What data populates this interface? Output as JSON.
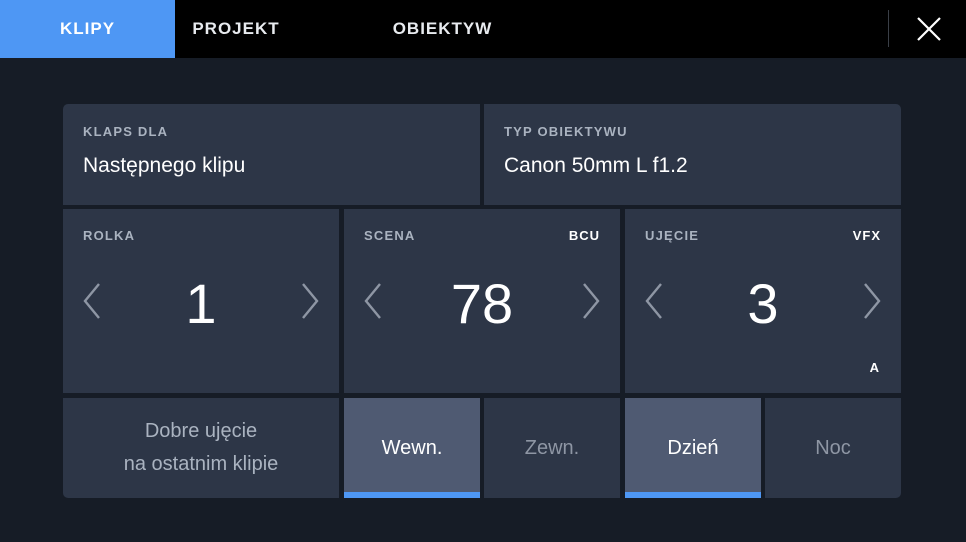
{
  "tabs": [
    {
      "label": "KLIPY",
      "active": true
    },
    {
      "label": "PROJEKT",
      "active": false
    },
    {
      "label": "OBIEKTYW",
      "active": false
    }
  ],
  "slate_for": {
    "label": "KLAPS DLA",
    "value": "Następnego klipu"
  },
  "lens_type": {
    "label": "TYP OBIEKTYWU",
    "value": "Canon 50mm L f1.2"
  },
  "reel": {
    "label": "ROLKA",
    "value": "1"
  },
  "scene": {
    "label": "SCENA",
    "value": "78",
    "tag": "BCU"
  },
  "take": {
    "label": "UJĘCIE",
    "value": "3",
    "tag": "VFX",
    "suffix": "A"
  },
  "good_take": {
    "line1": "Dobre ujęcie",
    "line2": "na ostatnim klipie"
  },
  "location_toggles": [
    {
      "label": "Wewn.",
      "selected": true
    },
    {
      "label": "Zewn.",
      "selected": false
    }
  ],
  "time_toggles": [
    {
      "label": "Dzień",
      "selected": true
    },
    {
      "label": "Noc",
      "selected": false
    }
  ],
  "colors": {
    "accent": "#4e97f4",
    "panel": "#2d3647",
    "selected": "#4f5a72",
    "background": "#161c26"
  }
}
